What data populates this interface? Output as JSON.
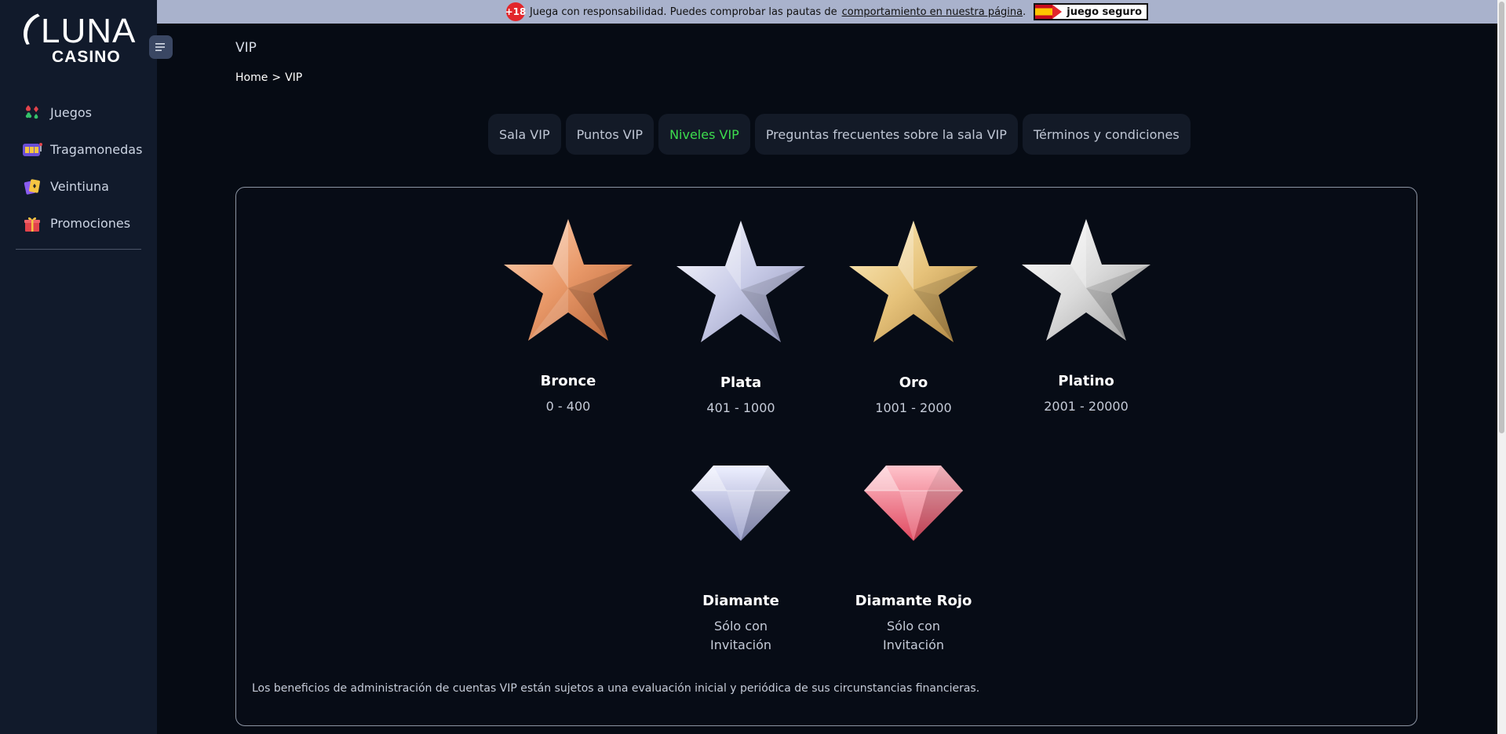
{
  "brand": {
    "logo_top": "LUNA",
    "logo_bottom": "CASINO"
  },
  "sidebar": {
    "items": [
      {
        "label": "Juegos",
        "icon": "cards-suits-icon"
      },
      {
        "label": "Tragamonedas",
        "icon": "slot-machine-icon"
      },
      {
        "label": "Veintiuna",
        "icon": "blackjack-cards-icon"
      },
      {
        "label": "Promociones",
        "icon": "gift-icon"
      }
    ]
  },
  "banner": {
    "age": "+18",
    "text": "Juega con responsabilidad. Puedes comprobar las pautas de",
    "link": "comportamiento en nuestra página",
    "trailing": ".",
    "badge_label": "juego seguro"
  },
  "page": {
    "title": "VIP"
  },
  "breadcrumb": {
    "home": "Home",
    "separator": ">",
    "current": "VIP"
  },
  "tabs": [
    {
      "label": "Sala VIP",
      "active": false
    },
    {
      "label": "Puntos VIP",
      "active": false
    },
    {
      "label": "Niveles VIP",
      "active": true
    },
    {
      "label": "Preguntas frecuentes sobre la sala VIP",
      "active": false
    },
    {
      "label": "Términos y condiciones",
      "active": false
    }
  ],
  "levels": [
    {
      "name": "Bronce",
      "range": "0 - 400",
      "icon": "bronze-star-icon"
    },
    {
      "name": "Plata",
      "range": "401 - 1000",
      "icon": "silver-star-icon"
    },
    {
      "name": "Oro",
      "range": "1001 - 2000",
      "icon": "gold-star-icon"
    },
    {
      "name": "Platino",
      "range": "2001 - 20000",
      "icon": "platinum-star-icon"
    },
    {
      "name": "Diamante",
      "range_line1": "Sólo con",
      "range_line2": "Invitación",
      "icon": "diamond-icon"
    },
    {
      "name": "Diamante Rojo",
      "range_line1": "Sólo con",
      "range_line2": "Invitación",
      "icon": "red-diamond-icon"
    }
  ],
  "disclaimer": "Los beneficios de administración de cuentas VIP están sujetos a una evaluación inicial y periódica de sus circunstancias financieras.",
  "colors": {
    "background": "#060b14",
    "sidebar": "#111a2b",
    "banner": "#a9b2cc",
    "active_tab": "#3ddc4e",
    "bronze": "#e89868",
    "silver": "#c9cce8",
    "gold": "#e6c27a",
    "platinum": "#dcdcdc",
    "red_diamond": "#f26a80"
  }
}
